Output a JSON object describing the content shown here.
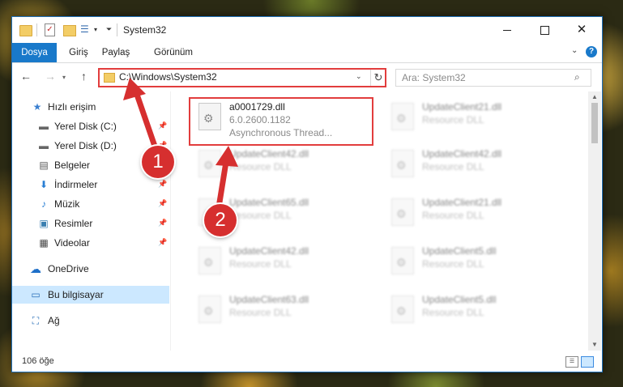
{
  "window": {
    "title": "System32",
    "controls": {
      "minimize_icon": "minimize-icon",
      "maximize_icon": "maximize-icon",
      "close_icon": "close-icon"
    }
  },
  "ribbon": {
    "tabs": [
      {
        "label": "Dosya",
        "active": true
      },
      {
        "label": "Giriş"
      },
      {
        "label": "Paylaş"
      },
      {
        "label": "Görünüm"
      }
    ],
    "accent_color": "#1979ca"
  },
  "navigation": {
    "address": "C:\\Windows\\System32",
    "search_placeholder": "Ara: System32"
  },
  "sidebar": {
    "items": [
      {
        "label": "Hızlı erişim",
        "icon": "star-icon"
      },
      {
        "label": "Yerel Disk (C:)",
        "icon": "drive-icon",
        "pinned": true
      },
      {
        "label": "Yerel Disk (D:)",
        "icon": "drive-icon",
        "pinned": true
      },
      {
        "label": "Belgeler",
        "icon": "documents-icon",
        "pinned": true
      },
      {
        "label": "İndirmeler",
        "icon": "download-icon",
        "pinned": true
      },
      {
        "label": "Müzik",
        "icon": "music-icon",
        "pinned": true
      },
      {
        "label": "Resimler",
        "icon": "pictures-icon",
        "pinned": true
      },
      {
        "label": "Videolar",
        "icon": "video-icon",
        "pinned": true
      },
      {
        "label": "OneDrive",
        "icon": "cloud-icon"
      },
      {
        "label": "Bu bilgisayar",
        "icon": "computer-icon",
        "selected": true
      },
      {
        "label": "Ağ",
        "icon": "network-icon"
      }
    ]
  },
  "files": [
    {
      "name": "a0001729.dll",
      "version": "6.0.2600.1182",
      "description": "Asynchronous Thread...",
      "highlighted": true
    },
    {
      "name": "UpdateClient21.dll",
      "description": "Resource DLL"
    },
    {
      "name": "UpdateClient42.dll",
      "description": "Resource DLL"
    },
    {
      "name": "UpdateClient42.dll",
      "description": "Resource DLL"
    },
    {
      "name": "UpdateClient65.dll",
      "description": "Resource DLL"
    },
    {
      "name": "UpdateClient21.dll",
      "description": "Resource DLL"
    },
    {
      "name": "UpdateClient42.dll",
      "description": "Resource DLL"
    },
    {
      "name": "UpdateClient5.dll",
      "description": "Resource DLL"
    },
    {
      "name": "UpdateClient63.dll",
      "description": "Resource DLL"
    },
    {
      "name": "UpdateClient5.dll",
      "description": "Resource DLL"
    }
  ],
  "status": {
    "item_count": "106 öğe"
  },
  "annotations": {
    "marker_1": "1",
    "marker_2": "2",
    "color": "#d62f2f"
  }
}
